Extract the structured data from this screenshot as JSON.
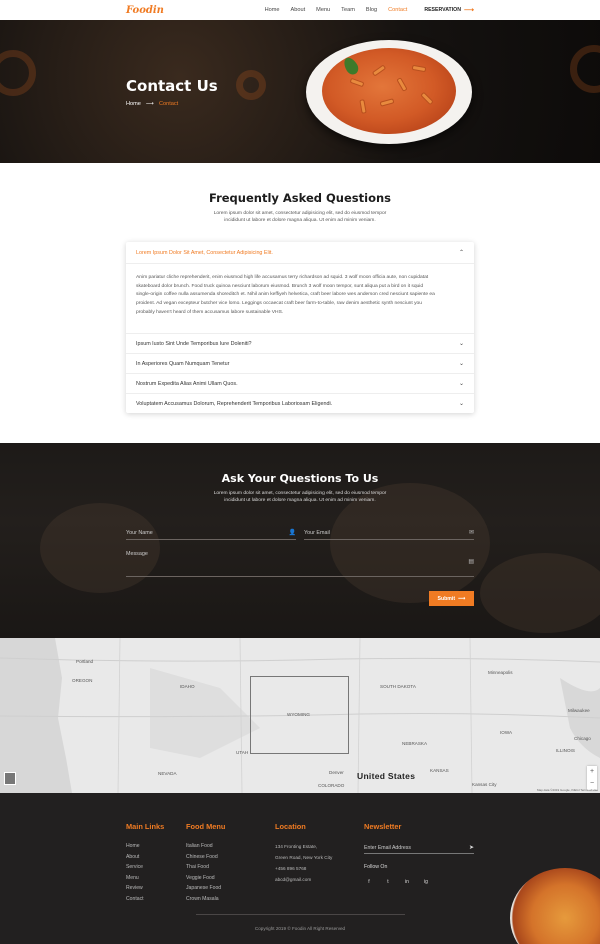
{
  "nav": {
    "logo": "Foodin",
    "links": [
      "Home",
      "About",
      "Menu",
      "Team",
      "Blog",
      "Contact"
    ],
    "active": "Contact",
    "reservation": "RESERVATION",
    "reservation_arrow": "⟶"
  },
  "hero": {
    "title": "Contact Us",
    "breadcrumb_home": "Home",
    "breadcrumb_arrow": "⟶",
    "breadcrumb_current": "Contact"
  },
  "faq": {
    "title": "Frequently Asked Questions",
    "subtitle_line1": "Lorem ipsum dolor sit amet, consectetur adipisicing elit, sed do eiusmod tempor",
    "subtitle_line2": "incididunt ut labore et dolore magna aliqua. Ut enim ad minim veniam.",
    "open_question": "Lorem Ipsum Dolor Sit Amet, Consectetur Adipisicing Elit.",
    "answer_lines": [
      "Anim pariatur cliche reprehenderit, enim eiusmod high life accusamus terry richardson ad squid. 3 wolf moon officia aute, non cupidatat",
      "skateboard dolor brunch. Food truck quinoa nesciunt laborum eiusmod. Brunch 3 wolf moon tempor, sunt aliqua put a bird on it squid",
      "single-origin coffee nulla assumenda shoreditch et. Nihil anim keffiyeh helvetica, craft beer labore wes anderson cred nesciunt sapiente ea",
      "proident. Ad vegan excepteur butcher vice lomo. Leggings occaecat craft beer farm-to-table, raw denim aesthetic synth nesciunt you",
      "probably haven't heard of them accusamus labore sustainable VHS."
    ],
    "questions": [
      "Ipsum Iusto Sint Unde Temporibus Iure Doleniti?",
      "In Asperiores Quam Numquam Tenetur",
      "Nostrum Expedita Alias Animi Ullam Quos.",
      "Voluptatem Accusamus Dolorum, Reprehenderit Temporibus Laboriosam Eligendi."
    ],
    "chevron_up": "⌃",
    "chevron_down": "⌄"
  },
  "contact": {
    "title": "Ask Your Questions To Us",
    "subtitle_line1": "Lorem ipsum dolor sit amet, consectetur adipisicing elit, sed do eiusmod tempor",
    "subtitle_line2": "incididunt ut labore et dolore magna aliqua. Ut enim ad minim veniam.",
    "name_placeholder": "Your Name",
    "email_placeholder": "Your Email",
    "message_placeholder": "Message",
    "submit": "Submit",
    "submit_arrow": "⟶",
    "user_icon": "👤",
    "mail_icon": "✉",
    "doc_icon": "▤"
  },
  "map": {
    "country": "United States",
    "labels": [
      "Portland",
      "OREGON",
      "IDAHO",
      "WYOMING",
      "NEVADA",
      "UTAH",
      "COLORADO",
      "Denver",
      "Minneapolis",
      "SOUTH DAKOTA",
      "NEBRASKA",
      "KANSAS",
      "IOWA",
      "Kansas City",
      "Milwaukee",
      "Chicago",
      "ILLINOIS"
    ],
    "zoom_in": "+",
    "zoom_out": "−",
    "attribution": "Map data ©2019 Google, INEGI   Terms of Use"
  },
  "footer": {
    "main_links_title": "Main Links",
    "main_links": [
      "Home",
      "About",
      "Service",
      "Menu",
      "Review",
      "Contact"
    ],
    "food_menu_title": "Food Menu",
    "food_menu": [
      "Italian Food",
      "Chinese Food",
      "Thai Food",
      "Veggie Food",
      "Japanese Food",
      "Crown Masala"
    ],
    "location_title": "Location",
    "address": [
      "134 Fronting Estate,",
      "Green Road, New York City",
      "+456 896 5768",
      "abcd@gmail.com"
    ],
    "newsletter_title": "Newsletter",
    "email_placeholder": "Enter Email Address",
    "send_icon": "➤",
    "follow_on": "Follow On",
    "social": [
      "f",
      "t",
      "in",
      "ig"
    ],
    "copyright": "Copyright 2019 © Foodin All Right Reserved"
  },
  "colors": {
    "accent": "#f07b23",
    "dark": "#222020"
  }
}
